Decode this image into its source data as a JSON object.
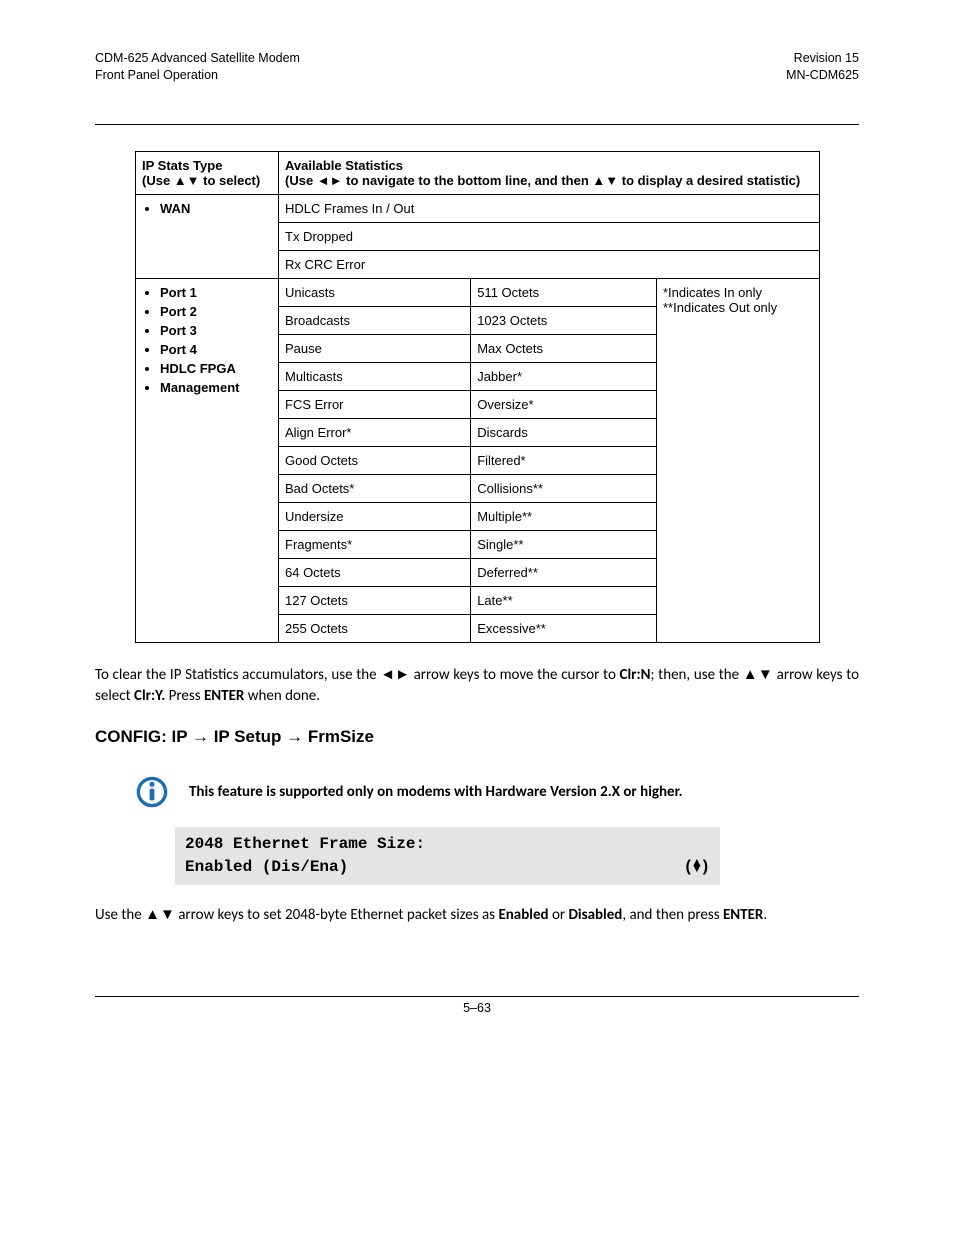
{
  "header": {
    "left1": "CDM-625 Advanced Satellite Modem",
    "left2": "Front Panel Operation",
    "right1": "Revision 15",
    "right2": "MN-CDM625"
  },
  "table": {
    "head_type": "IP Stats Type",
    "head_type_sub": "(Use ▲▼ to select)",
    "head_stats": "Available Statistics",
    "head_stats_sub": "(Use ◄► to navigate to the bottom line, and then ▲▼ to display a desired statistic)",
    "wan_label": "WAN",
    "wan_rows": [
      "HDLC Frames In / Out",
      "Tx Dropped",
      "Rx CRC Error"
    ],
    "port_labels": [
      "Port 1",
      "Port 2",
      "Port 3",
      "Port 4",
      "HDLC FPGA",
      "Management"
    ],
    "port_note1": "*Indicates In only",
    "port_note2": "**Indicates Out only",
    "port_rows": [
      [
        "Unicasts",
        "511 Octets"
      ],
      [
        "Broadcasts",
        "1023 Octets"
      ],
      [
        "Pause",
        "Max Octets"
      ],
      [
        "Multicasts",
        "Jabber*"
      ],
      [
        "FCS Error",
        "Oversize*"
      ],
      [
        "Align Error*",
        "Discards"
      ],
      [
        "Good Octets",
        "Filtered*"
      ],
      [
        "Bad Octets*",
        "Collisions**"
      ],
      [
        "Undersize",
        "Multiple**"
      ],
      [
        "Fragments*",
        "Single**"
      ],
      [
        "64 Octets",
        "Deferred**"
      ],
      [
        "127 Octets",
        "Late**"
      ],
      [
        "255 Octets",
        "Excessive**"
      ]
    ]
  },
  "para1_a": "To clear the IP Statistics accumulators, use the ◄► arrow keys to move the cursor to ",
  "para1_b": "Clr:N",
  "para1_c": "; then, use the ▲▼ arrow keys to select ",
  "para1_d": "Clr:Y.",
  "para1_e": " Press ",
  "para1_f": "ENTER",
  "para1_g": " when done.",
  "heading": "CONFIG: IP → IP Setup → FrmSize",
  "note": "This feature is supported only on modems with Hardware Version 2.X or higher.",
  "lcd_line1": "2048 Ethernet Frame Size:",
  "lcd_line2_left": "Enabled (Dis/Ena)",
  "para2_a": "Use the ▲▼ arrow keys to set 2048-byte Ethernet packet sizes as ",
  "para2_b": "Enabled",
  "para2_c": " or ",
  "para2_d": "Disabled",
  "para2_e": ", and then press ",
  "para2_f": "ENTER",
  "para2_g": ".",
  "footer": "5–63"
}
